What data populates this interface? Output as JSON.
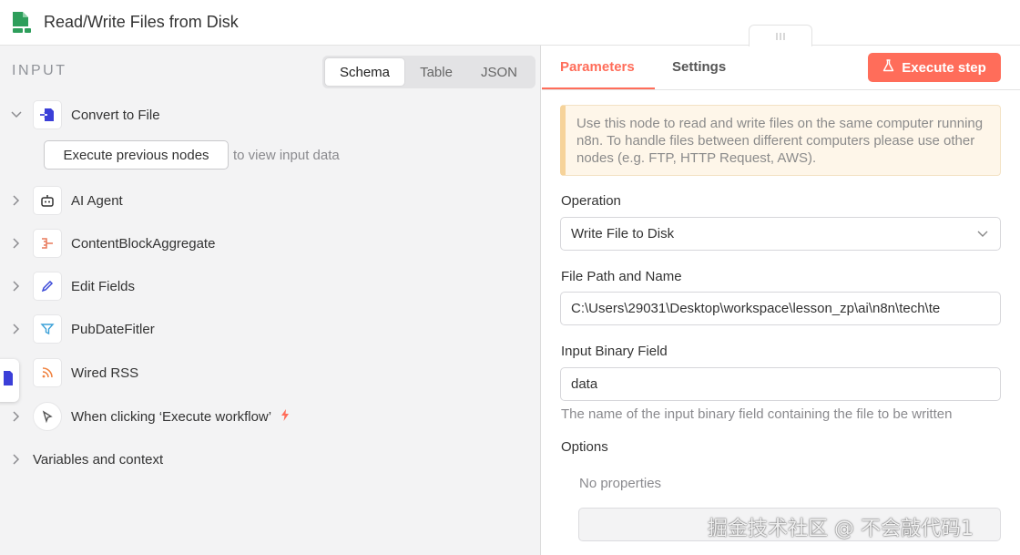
{
  "header": {
    "title": "Read/Write Files from Disk",
    "icon": "file-disk-icon",
    "icon_color": "#2e9e5b"
  },
  "input_panel": {
    "label": "INPUT",
    "view_options": [
      "Schema",
      "Table",
      "JSON"
    ],
    "selected_view": "Schema",
    "current_node": {
      "label": "Convert to File",
      "icon": "convert-file-icon",
      "execute_button": "Execute previous nodes",
      "hint": "to view input data"
    },
    "nodes": [
      {
        "label": "AI Agent",
        "icon": "robot-icon"
      },
      {
        "label": "ContentBlockAggregate",
        "icon": "aggregate-icon"
      },
      {
        "label": "Edit Fields",
        "icon": "pencil-icon"
      },
      {
        "label": "PubDateFitler",
        "icon": "filter-icon"
      },
      {
        "label": "Wired RSS",
        "icon": "rss-icon"
      },
      {
        "label": "When clicking ‘Execute workflow’",
        "icon": "cursor-icon"
      }
    ],
    "variables": "Variables and context"
  },
  "params_panel": {
    "tabs": [
      "Parameters",
      "Settings"
    ],
    "active_tab": "Parameters",
    "execute_button": "Execute step",
    "notice": "Use this node to read and write files on the same computer running n8n. To handle files between different computers please use other nodes (e.g. FTP, HTTP Request, AWS).",
    "operation": {
      "label": "Operation",
      "value": "Write File to Disk"
    },
    "file_path": {
      "label": "File Path and Name",
      "value": "C:\\Users\\29031\\Desktop\\workspace\\lesson_zp\\ai\\n8n\\tech\\te"
    },
    "binary_field": {
      "label": "Input Binary Field",
      "value": "data",
      "hint": "The name of the input binary field containing the file to be written"
    },
    "options": {
      "label": "Options",
      "empty_text": "No properties"
    }
  },
  "watermark": "掘金技术社区 @ 不会敲代码1",
  "colors": {
    "accent": "#ff6d5a",
    "notice_bg": "#fef6e9",
    "panel_bg": "#f3f3f4"
  }
}
